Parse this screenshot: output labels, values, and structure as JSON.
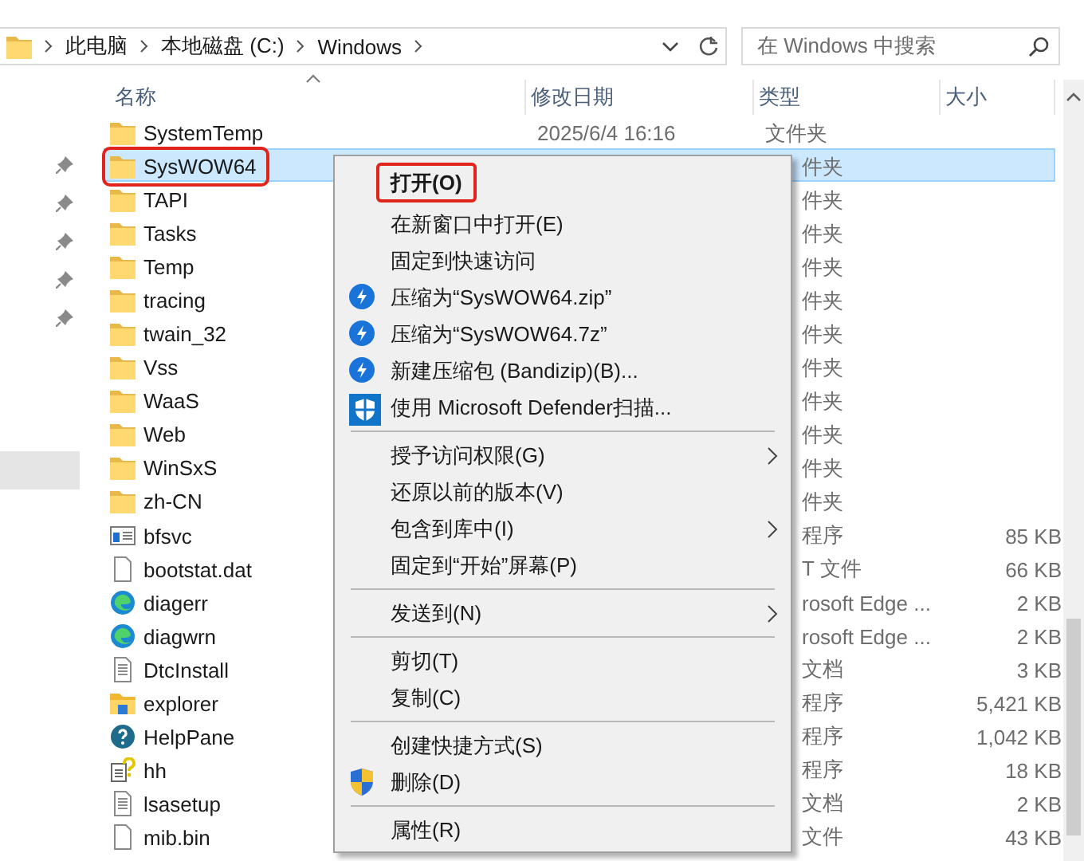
{
  "address_bar": {
    "path": [
      "此电脑",
      "本地磁盘 (C:)",
      "Windows"
    ]
  },
  "search": {
    "placeholder": "在 Windows 中搜索"
  },
  "nav_pane": {
    "items": [
      {
        "pinned": true,
        "selected": false
      },
      {
        "pinned": true,
        "selected": false
      },
      {
        "pinned": true,
        "selected": false
      },
      {
        "pinned": true,
        "selected": false
      },
      {
        "pinned": true,
        "selected": false
      },
      {
        "pinned": false,
        "selected": false
      },
      {
        "pinned": false,
        "selected": false
      },
      {
        "pinned": false,
        "selected": false
      },
      {
        "pinned": false,
        "selected": true
      }
    ]
  },
  "columns": [
    {
      "label": "名称",
      "sorted": true
    },
    {
      "label": "修改日期",
      "sorted": false
    },
    {
      "label": "类型",
      "sorted": false
    },
    {
      "label": "大小",
      "sorted": false
    }
  ],
  "rows": [
    {
      "name": "SystemTemp",
      "kind": "folder",
      "date": "2025/6/4 16:16",
      "type": "文件夹",
      "behind_menu": false,
      "selected": false,
      "highlighted": false
    },
    {
      "name": "SysWOW64",
      "kind": "folder",
      "type": "件夹",
      "behind_menu": true,
      "selected": true,
      "highlighted": true
    },
    {
      "name": "TAPI",
      "kind": "folder",
      "type": "件夹",
      "behind_menu": true,
      "selected": false,
      "highlighted": false
    },
    {
      "name": "Tasks",
      "kind": "folder",
      "type": "件夹",
      "behind_menu": true,
      "selected": false,
      "highlighted": false
    },
    {
      "name": "Temp",
      "kind": "folder",
      "type": "件夹",
      "behind_menu": true,
      "selected": false,
      "highlighted": false
    },
    {
      "name": "tracing",
      "kind": "folder",
      "type": "件夹",
      "behind_menu": true,
      "selected": false,
      "highlighted": false
    },
    {
      "name": "twain_32",
      "kind": "folder",
      "type": "件夹",
      "behind_menu": true,
      "selected": false,
      "highlighted": false
    },
    {
      "name": "Vss",
      "kind": "folder",
      "type": "件夹",
      "behind_menu": true,
      "selected": false,
      "highlighted": false
    },
    {
      "name": "WaaS",
      "kind": "folder",
      "type": "件夹",
      "behind_menu": true,
      "selected": false,
      "highlighted": false
    },
    {
      "name": "Web",
      "kind": "folder",
      "type": "件夹",
      "behind_menu": true,
      "selected": false,
      "highlighted": false
    },
    {
      "name": "WinSxS",
      "kind": "folder",
      "type": "件夹",
      "behind_menu": true,
      "selected": false,
      "highlighted": false
    },
    {
      "name": "zh-CN",
      "kind": "folder",
      "type": "件夹",
      "behind_menu": true,
      "selected": false,
      "highlighted": false
    },
    {
      "name": "bfsvc",
      "kind": "app",
      "type": "程序",
      "size": "85 KB",
      "behind_menu": true,
      "selected": false,
      "highlighted": false
    },
    {
      "name": "bootstat.dat",
      "kind": "file",
      "type": "T 文件",
      "size": "66 KB",
      "behind_menu": true,
      "selected": false,
      "highlighted": false
    },
    {
      "name": "diagerr",
      "kind": "edge",
      "type": "rosoft Edge ...",
      "size": "2 KB",
      "behind_menu": true,
      "selected": false,
      "highlighted": false
    },
    {
      "name": "diagwrn",
      "kind": "edge",
      "type": "rosoft Edge ...",
      "size": "2 KB",
      "behind_menu": true,
      "selected": false,
      "highlighted": false
    },
    {
      "name": "DtcInstall",
      "kind": "text",
      "type": "文档",
      "size": "3 KB",
      "behind_menu": true,
      "selected": false,
      "highlighted": false
    },
    {
      "name": "explorer",
      "kind": "explorer",
      "type": "程序",
      "size": "5,421 KB",
      "behind_menu": true,
      "selected": false,
      "highlighted": false
    },
    {
      "name": "HelpPane",
      "kind": "help",
      "type": "程序",
      "size": "1,042 KB",
      "behind_menu": true,
      "selected": false,
      "highlighted": false
    },
    {
      "name": "hh",
      "kind": "helpdoc",
      "type": "程序",
      "size": "18 KB",
      "behind_menu": true,
      "selected": false,
      "highlighted": false
    },
    {
      "name": "lsasetup",
      "kind": "text",
      "type": "文档",
      "size": "2 KB",
      "behind_menu": true,
      "selected": false,
      "highlighted": false
    },
    {
      "name": "mib.bin",
      "kind": "file",
      "type": "文件",
      "size": "43 KB",
      "behind_menu": true,
      "selected": false,
      "highlighted": false
    }
  ],
  "context_menu": {
    "entries": [
      {
        "kind": "item",
        "label": "打开(O)",
        "default": true,
        "highlighted": true,
        "submenu": false
      },
      {
        "kind": "item",
        "label": "在新窗口中打开(E)",
        "default": false,
        "highlighted": false,
        "submenu": false
      },
      {
        "kind": "item",
        "label": "固定到快速访问",
        "default": false,
        "highlighted": false,
        "submenu": false
      },
      {
        "kind": "zip_item",
        "label": "压缩为“SysWOW64.zip”",
        "default": false,
        "highlighted": false,
        "submenu": false
      },
      {
        "kind": "zip_item",
        "label": "压缩为“SysWOW64.7z”",
        "default": false,
        "highlighted": false,
        "submenu": false
      },
      {
        "kind": "zip_item",
        "label": "新建压缩包 (Bandizip)(B)...",
        "default": false,
        "highlighted": false,
        "submenu": false
      },
      {
        "kind": "scan_item",
        "label": "使用 Microsoft Defender扫描...",
        "default": false,
        "highlighted": false,
        "submenu": false
      },
      {
        "kind": "separator"
      },
      {
        "kind": "item",
        "label": "授予访问权限(G)",
        "default": false,
        "highlighted": false,
        "submenu": true
      },
      {
        "kind": "item",
        "label": "还原以前的版本(V)",
        "default": false,
        "highlighted": false,
        "submenu": false
      },
      {
        "kind": "item",
        "label": "包含到库中(I)",
        "default": false,
        "highlighted": false,
        "submenu": true
      },
      {
        "kind": "item",
        "label": "固定到“开始”屏幕(P)",
        "default": false,
        "highlighted": false,
        "submenu": false
      },
      {
        "kind": "separator"
      },
      {
        "kind": "item",
        "label": "发送到(N)",
        "default": false,
        "highlighted": false,
        "submenu": true
      },
      {
        "kind": "separator"
      },
      {
        "kind": "item",
        "label": "剪切(T)",
        "default": false,
        "highlighted": false,
        "submenu": false
      },
      {
        "kind": "item",
        "label": "复制(C)",
        "default": false,
        "highlighted": false,
        "submenu": false
      },
      {
        "kind": "separator"
      },
      {
        "kind": "item",
        "label": "创建快捷方式(S)",
        "default": false,
        "highlighted": false,
        "submenu": false
      },
      {
        "kind": "admin_item",
        "label": "删除(D)",
        "default": false,
        "highlighted": false,
        "submenu": false
      },
      {
        "kind": "separator"
      },
      {
        "kind": "item",
        "label": "属性(R)",
        "default": false,
        "highlighted": false,
        "submenu": false
      }
    ]
  }
}
